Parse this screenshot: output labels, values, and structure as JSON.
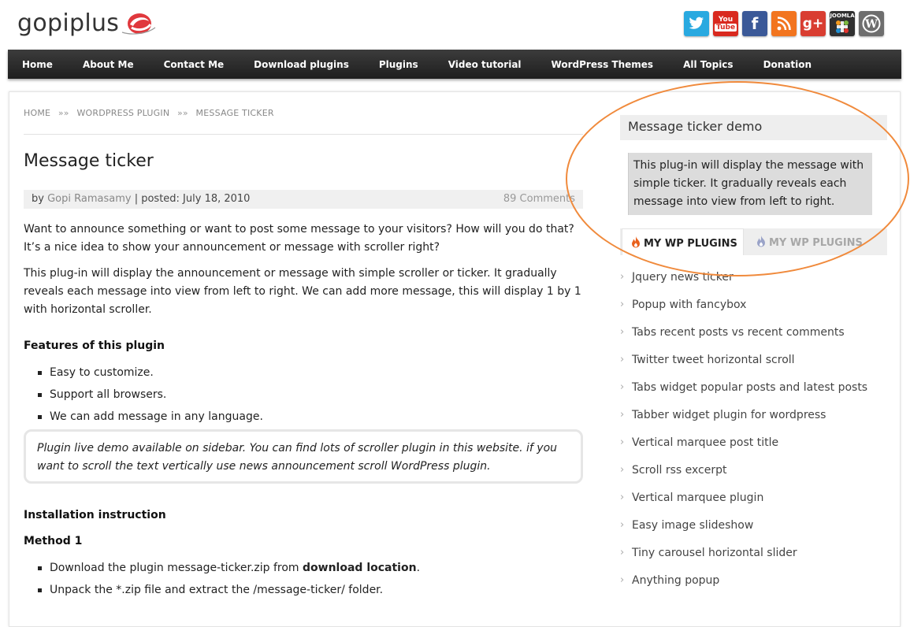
{
  "logo": {
    "text": "gopiplus"
  },
  "social": [
    {
      "name": "twitter",
      "glyph": "t",
      "color": "#29a9e0"
    },
    {
      "name": "youtube",
      "glyph": "You Tube",
      "color": "#d9291f"
    },
    {
      "name": "facebook",
      "glyph": "f",
      "color": "#3b5998"
    },
    {
      "name": "rss",
      "glyph": "◉",
      "color": "#f2751f"
    },
    {
      "name": "google-plus",
      "glyph": "g+",
      "color": "#d93d31"
    },
    {
      "name": "joomla",
      "glyph": "✚",
      "color": "#303030"
    },
    {
      "name": "wordpress",
      "glyph": "W",
      "color": "#707070"
    }
  ],
  "nav": [
    "Home",
    "About Me",
    "Contact Me",
    "Download plugins",
    "Plugins",
    "Video tutorial",
    "WordPress Themes",
    "All Topics",
    "Donation"
  ],
  "breadcrumb": {
    "home": "HOME",
    "sep": "»»",
    "section": "WORDPRESS PLUGIN",
    "current": "MESSAGE TICKER"
  },
  "post": {
    "title": "Message ticker",
    "meta": {
      "by": "by",
      "author": "Gopi Ramasamy",
      "posted": "| posted: July 18, 2010",
      "comments": "89 Comments"
    },
    "para1": "Want to announce something or want to post some message to your visitors? How will you do that? It’s a nice idea to show your announcement or message with scroller right?",
    "para2": "This plug-in will display the announcement or message with simple scroller or ticker. It gradually reveals each message into view from left to right. We can add more message, this will display 1 by 1 with horizontal scroller.",
    "features_heading": "Features of this plugin",
    "features": [
      "Easy to customize.",
      "Support all browsers.",
      "We can add message in any language."
    ],
    "note": "Plugin live demo available on sidebar. You can find lots of scroller plugin in this website. if you want to scroll the text vertically use news announcement scroll WordPress plugin.",
    "install_heading": "Installation instruction",
    "method_heading": "Method 1",
    "steps": {
      "step1_prefix": "Download the plugin message-ticker.zip from ",
      "step1_link": "download location",
      "step1_suffix": ".",
      "step2": "Unpack the *.zip file and extract the /message-ticker/ folder."
    }
  },
  "sidebar": {
    "demo_title": "Message ticker demo",
    "demo_text": "This plug-in will display the message with simple ticker. It gradually reveals each message into view from left to right.",
    "tab_active": "MY WP PLUGINS",
    "tab_inactive": "MY WP PLUGINS",
    "plugins": [
      "Jquery news ticker",
      "Popup with fancybox",
      "Tabs recent posts vs recent comments",
      "Twitter tweet horizontal scroll",
      "Tabs widget popular posts and latest posts",
      "Tabber widget plugin for wordpress",
      "Vertical marquee post title",
      "Scroll rss excerpt",
      "Vertical marquee plugin",
      "Easy image slideshow",
      "Tiny carousel horizontal slider",
      "Anything popup"
    ]
  },
  "colors": {
    "accent": "#f08a3c",
    "nav_bg": "#2a2a2a",
    "flame_active": "#e8601c",
    "flame_inactive": "#9aa3c8"
  }
}
